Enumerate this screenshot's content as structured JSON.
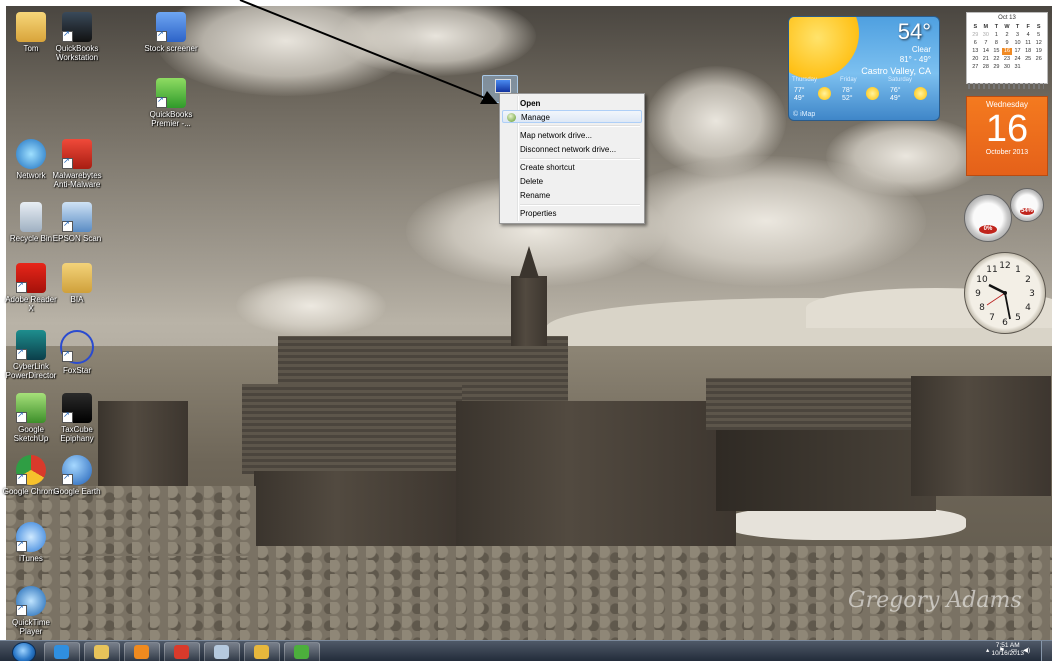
{
  "desktop": {
    "icons": [
      {
        "label": "Tom"
      },
      {
        "label": "QuickBooks Workstation"
      },
      {
        "label": "Stock screener"
      },
      {
        "label": "QuickBooks Premier -..."
      },
      {
        "label": "Network"
      },
      {
        "label": "Malwarebytes Anti-Malware"
      },
      {
        "label": "Recycle Bin"
      },
      {
        "label": "EPSON Scan"
      },
      {
        "label": "Adobe Reader X"
      },
      {
        "label": "BIA"
      },
      {
        "label": "CyberLink PowerDirector"
      },
      {
        "label": "FoxStar"
      },
      {
        "label": "Google SketchUp"
      },
      {
        "label": "TaxCube Epiphany"
      },
      {
        "label": "Google Chrome"
      },
      {
        "label": "Google Earth"
      },
      {
        "label": "iTunes"
      },
      {
        "label": "QuickTime Player"
      }
    ],
    "signature": "Gregory Adams"
  },
  "context_menu": {
    "items": [
      {
        "label": "Open",
        "bold": true
      },
      {
        "label": "Manage",
        "highlighted": true,
        "icon": "shield-icon"
      },
      {
        "label": "Map network drive..."
      },
      {
        "label": "Disconnect network drive..."
      },
      {
        "label": "Create shortcut"
      },
      {
        "label": "Delete"
      },
      {
        "label": "Rename"
      },
      {
        "label": "Properties"
      }
    ]
  },
  "weather": {
    "temperature": "54°",
    "condition": "Clear",
    "range": "81° - 49°",
    "location": "Castro Valley, CA",
    "forecast": [
      {
        "day": "Thursday",
        "hi": "77°",
        "lo": "49°"
      },
      {
        "day": "Friday",
        "hi": "78°",
        "lo": "52°"
      },
      {
        "day": "Saturday",
        "hi": "76°",
        "lo": "49°"
      }
    ],
    "source": "© iMap"
  },
  "calendar": {
    "month_header": "Oct 13",
    "weekdays": [
      "S",
      "M",
      "T",
      "W",
      "T",
      "F",
      "S"
    ],
    "days": [
      "29",
      "30",
      "1",
      "2",
      "3",
      "4",
      "5",
      "6",
      "7",
      "8",
      "9",
      "10",
      "11",
      "12",
      "13",
      "14",
      "15",
      "16",
      "17",
      "18",
      "19",
      "20",
      "21",
      "22",
      "23",
      "24",
      "25",
      "26",
      "27",
      "28",
      "29",
      "30",
      "31",
      "",
      ""
    ],
    "today": "16",
    "weekday_name": "Wednesday",
    "day_number": "16",
    "month_year": "October 2013"
  },
  "meter": {
    "cpu": "0%",
    "ram": "54%"
  },
  "taskbar": {
    "pinned": [
      {
        "name": "internet-explorer-icon",
        "color": "#2f8fe0"
      },
      {
        "name": "libraries-icon",
        "color": "#e8c35a"
      },
      {
        "name": "media-player-icon",
        "color": "#f08a1e"
      },
      {
        "name": "chrome-icon",
        "color": "#d93a2b"
      },
      {
        "name": "folder-icon",
        "color": "#b5c9de"
      },
      {
        "name": "mail-icon",
        "color": "#e7b73c"
      },
      {
        "name": "quickbooks-icon",
        "color": "#4caf3c"
      }
    ],
    "time": "7:51 AM",
    "date": "10/16/2013"
  }
}
